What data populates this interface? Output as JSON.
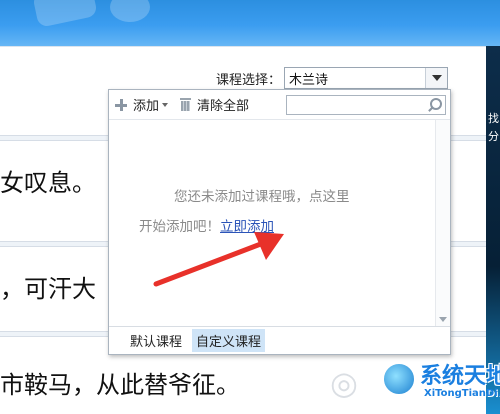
{
  "course": {
    "label": "课程选择：",
    "selected": "木兰诗"
  },
  "panel": {
    "add_label": "添加",
    "clear_label": "清除全部",
    "search_placeholder": "",
    "empty_line1": "您还未添加过课程哦，点这里",
    "empty_line2": "开始添加吧！",
    "add_now_link": "立即添加",
    "tabs": [
      "默认课程",
      "自定义课程"
    ],
    "active_tab": "自定义课程"
  },
  "main": {
    "lines": [
      "女叹息。",
      "，可汗大",
      "市鞍马，从此替爷征。"
    ]
  },
  "right_strip": {
    "text": "找 分"
  },
  "watermark": {
    "title": "系统天地",
    "url": "XiTongTianDi.net"
  },
  "colors": {
    "accent": "#2c8fe0",
    "link": "#2b54b8",
    "annotation_arrow": "#e8312a"
  },
  "icons": [
    "plus-icon",
    "trash-icon",
    "search-icon",
    "chevron-down-icon",
    "arrow-annotation"
  ]
}
